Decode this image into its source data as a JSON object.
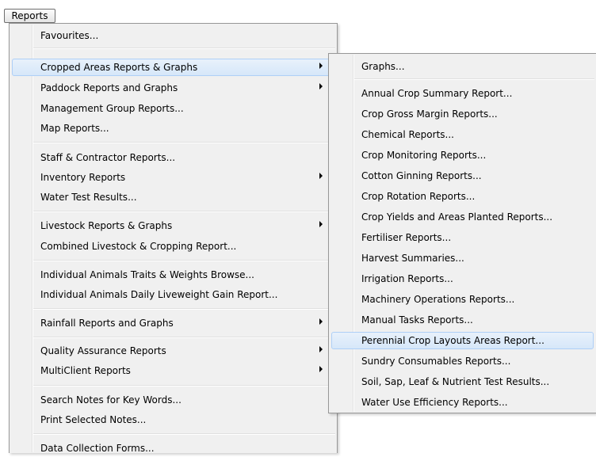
{
  "menubar": {
    "reports_label": "Reports"
  },
  "main_menu": {
    "items": [
      {
        "label": "Favourites..."
      },
      {
        "label": "Cropped Areas Reports & Graphs"
      },
      {
        "label": "Paddock Reports and Graphs"
      },
      {
        "label": "Management Group Reports..."
      },
      {
        "label": "Map Reports..."
      },
      {
        "label": "Staff & Contractor Reports..."
      },
      {
        "label": "Inventory Reports"
      },
      {
        "label": "Water Test Results..."
      },
      {
        "label": "Livestock Reports & Graphs"
      },
      {
        "label": "Combined Livestock & Cropping Report..."
      },
      {
        "label": "Individual Animals Traits & Weights Browse..."
      },
      {
        "label": "Individual Animals Daily Liveweight Gain Report..."
      },
      {
        "label": "Rainfall Reports and Graphs"
      },
      {
        "label": "Quality Assurance Reports"
      },
      {
        "label": "MultiClient Reports"
      },
      {
        "label": "Search Notes for Key Words..."
      },
      {
        "label": "Print Selected Notes..."
      },
      {
        "label": "Data Collection Forms..."
      }
    ]
  },
  "sub_menu": {
    "items": [
      {
        "label": "Graphs..."
      },
      {
        "label": "Annual Crop Summary Report..."
      },
      {
        "label": "Crop Gross Margin Reports..."
      },
      {
        "label": "Chemical Reports..."
      },
      {
        "label": "Crop Monitoring Reports..."
      },
      {
        "label": "Cotton Ginning Reports..."
      },
      {
        "label": "Crop Rotation Reports..."
      },
      {
        "label": "Crop Yields and Areas Planted Reports..."
      },
      {
        "label": "Fertiliser Reports..."
      },
      {
        "label": "Harvest Summaries..."
      },
      {
        "label": "Irrigation Reports..."
      },
      {
        "label": "Machinery Operations Reports..."
      },
      {
        "label": "Manual Tasks Reports..."
      },
      {
        "label": "Perennial Crop Layouts  Areas Report..."
      },
      {
        "label": "Sundry Consumables Reports..."
      },
      {
        "label": "Soil, Sap, Leaf & Nutrient Test Results..."
      },
      {
        "label": "Water Use Efficiency Reports..."
      }
    ]
  },
  "colors": {
    "highlight": "#d6e7f9",
    "highlight_border": "#aecff7",
    "menu_bg": "#f0f0f0"
  },
  "icons": {
    "submenu": "chevron-right-icon"
  }
}
